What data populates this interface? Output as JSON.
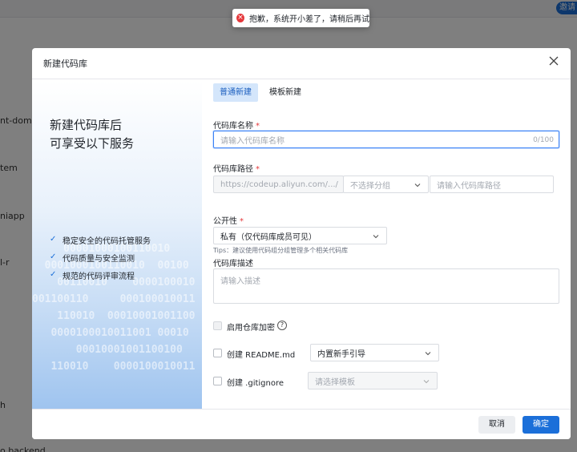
{
  "background": {
    "top_button": "邀请",
    "items": [
      "nt-doma",
      "tem",
      "niapp",
      "l-r",
      "h",
      "o backend"
    ]
  },
  "toast": {
    "icon": "error-x-icon",
    "message": "抱歉，系统开小差了，请稍后再试"
  },
  "modal": {
    "title": "新建代码库",
    "left": {
      "heading": "新建代码库后\n可享受以下服务",
      "features": [
        "稳定安全的代码托管服务",
        "代码质量与安全监测",
        "规范的代码评审流程"
      ]
    },
    "tabs": [
      {
        "label": "普通新建",
        "active": true
      },
      {
        "label": "模板新建",
        "active": false
      }
    ],
    "form": {
      "name_label": "代码库名称",
      "name_placeholder": "请输入代码库名称",
      "name_counter": "0/100",
      "path_label": "代码库路径",
      "path_prefix": "https://codeup.aliyun.com/.../",
      "group_select": "不选择分组",
      "path_placeholder": "请输入代码库路径",
      "tips": "Tips：建议使用代码组分组管理多个相关代码库",
      "visibility_label": "公开性",
      "visibility_value": "私有（仅代码库成员可见）",
      "desc_label": "代码库描述",
      "desc_placeholder": "请输入描述",
      "encrypt_label": "启用仓库加密",
      "readme_label": "创建 README.md",
      "readme_select": "内置新手引导",
      "gitignore_label": "创建 .gitignore",
      "gitignore_select": "请选择模板"
    },
    "footer": {
      "cancel": "取消",
      "confirm": "确定"
    }
  },
  "colors": {
    "primary": "#1b6fd9",
    "required": "#e5383b",
    "error": "#e5383b"
  }
}
